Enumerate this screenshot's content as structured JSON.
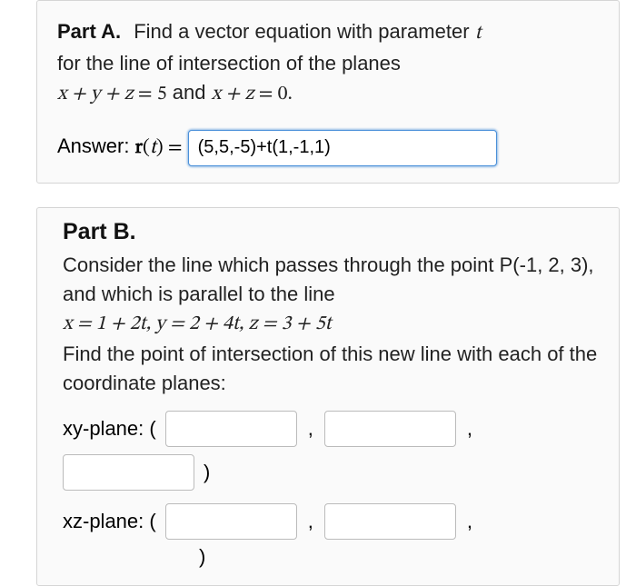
{
  "partA": {
    "heading": "Part A.",
    "question_line1": "Find a vector equation with parameter ",
    "question_param": "t",
    "question_line2": "for the line of intersection of the planes",
    "eq1_lhs": "x + y + z",
    "eq1_eq": " = ",
    "eq1_rhs": "5",
    "eq_joiner": " and ",
    "eq2_lhs": "x + z",
    "eq2_eq": " = ",
    "eq2_rhs": "0",
    "eq_period": ".",
    "answer_label": "Answer: ",
    "answer_rt_bold": "r",
    "answer_rt_paren_open": "(",
    "answer_rt_t": "t",
    "answer_rt_paren_close": ")",
    "answer_eq": " = ",
    "answer_value": "(5,5,-5)+t(1,-1,1)"
  },
  "partB": {
    "heading": "Part B.",
    "intro": "Consider the line which passes through the point P(-1, 2, 3), and which is parallel to the line",
    "param_eq": "x = 1 + 2t, y = 2 + 4t, z = 3 + 5t",
    "instruction": "Find the point of intersection of this new line with each of the coordinate planes:",
    "xy_label": "xy-plane: (",
    "xz_label": "xz-plane: (",
    "comma": ",",
    "close_paren": ")",
    "xy_val1": "",
    "xy_val2": "",
    "xy_val3": "",
    "xz_val1": "",
    "xz_val2": ""
  }
}
